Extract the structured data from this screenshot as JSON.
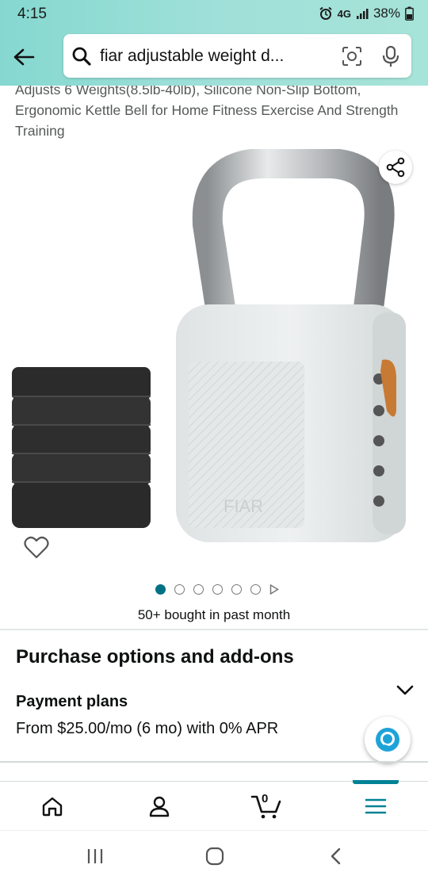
{
  "status_bar": {
    "time": "4:15",
    "network": "4G",
    "battery": "38%"
  },
  "search": {
    "query": "fiar adjustable weight d...",
    "icons": [
      "back-arrow-icon",
      "search-icon",
      "camera-icon",
      "mic-icon"
    ]
  },
  "product": {
    "title_partial": "Adjusts 6 Weights(8.5lb-40lb), Silicone Non-Slip Bottom, Ergonomic Kettle Bell for Home Fitness Exercise And Strength Training",
    "image_logo": "FIAR",
    "image_count": 6,
    "active_image_index": 0,
    "bought_text": "50+ bought in past month"
  },
  "purchase": {
    "heading": "Purchase options and add-ons",
    "payment_plans_label": "Payment plans",
    "payment_plans_detail": "From $25.00/mo (6 mo) with 0% APR"
  },
  "bottom_nav": {
    "items": [
      "home",
      "account",
      "cart",
      "menu"
    ],
    "cart_count": "0",
    "active": "menu"
  },
  "colors": {
    "header_teal": "#9fe0d9",
    "accent_teal": "#008296",
    "active_dot": "#007185"
  }
}
